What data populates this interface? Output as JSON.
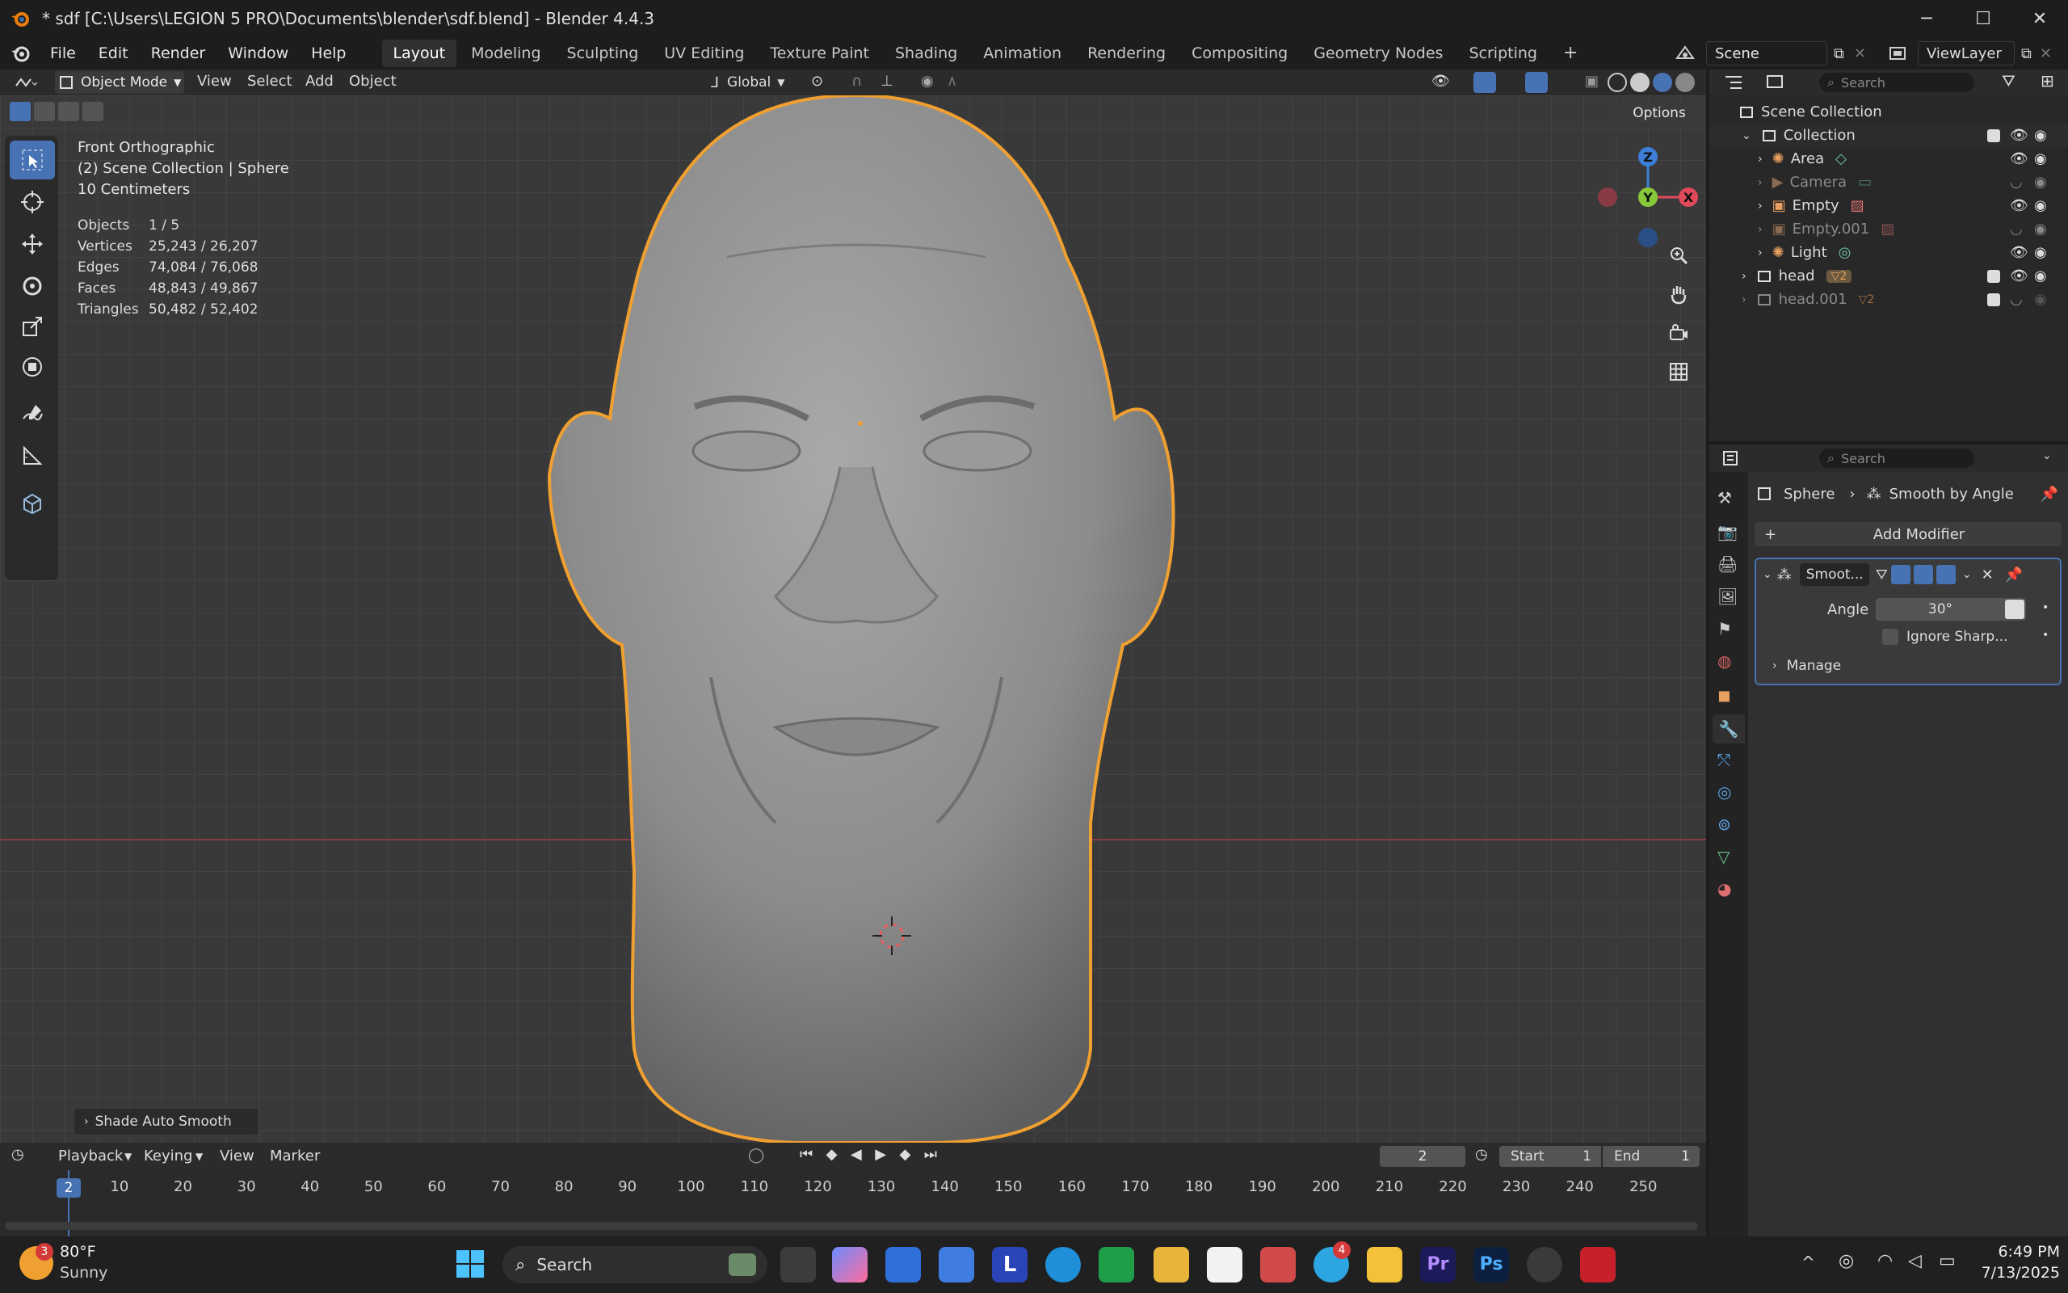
{
  "window": {
    "title": "* sdf [C:\\Users\\LEGION 5 PRO\\Documents\\blender\\sdf.blend] - Blender 4.4.3",
    "minimize": "─",
    "maximize": "☐",
    "close": "✕"
  },
  "menu": {
    "items": [
      "File",
      "Edit",
      "Render",
      "Window",
      "Help"
    ],
    "workspaces": [
      "Layout",
      "Modeling",
      "Sculpting",
      "UV Editing",
      "Texture Paint",
      "Shading",
      "Animation",
      "Rendering",
      "Compositing",
      "Geometry Nodes",
      "Scripting"
    ],
    "active_workspace": "Layout",
    "add_tab": "+",
    "scene": "Scene",
    "view_layer": "ViewLayer"
  },
  "viewport_header": {
    "mode": "Object Mode",
    "menus": [
      "View",
      "Select",
      "Add",
      "Object"
    ],
    "orientation": "Global",
    "options": "Options"
  },
  "viewport": {
    "view_name": "Front Orthographic",
    "collection_path": "(2) Scene Collection | Sphere",
    "scale": "10 Centimeters",
    "stats": [
      {
        "label": "Objects",
        "value": "1 / 5"
      },
      {
        "label": "Vertices",
        "value": "25,243 / 26,207"
      },
      {
        "label": "Edges",
        "value": "74,084 / 76,068"
      },
      {
        "label": "Faces",
        "value": "48,843 / 49,867"
      },
      {
        "label": "Triangles",
        "value": "50,482 / 52,402"
      }
    ],
    "gizmo_axes": {
      "z": "Z",
      "y": "Y",
      "x": "X"
    },
    "last_operation": "Shade Auto Smooth"
  },
  "outliner": {
    "search_placeholder": "Search",
    "root": "Scene Collection",
    "collection": "Collection",
    "items": [
      {
        "name": "Area",
        "dim": false
      },
      {
        "name": "Camera",
        "dim": true
      },
      {
        "name": "Empty",
        "dim": false
      },
      {
        "name": "Empty.001",
        "dim": true
      },
      {
        "name": "Light",
        "dim": false
      }
    ],
    "head": "head",
    "head_badge": "2",
    "head001": "head.001",
    "head001_badge": "2"
  },
  "properties": {
    "search_placeholder": "Search",
    "breadcrumb_object": "Sphere",
    "breadcrumb_modifier": "Smooth by Angle",
    "add_modifier": "Add Modifier",
    "modifier_name": "Smoot...",
    "angle_label": "Angle",
    "angle_value": "30°",
    "ignore_sharp": "Ignore Sharp...",
    "manage": "Manage"
  },
  "timeline": {
    "menus": [
      "Playback",
      "Keying",
      "View",
      "Marker"
    ],
    "current_frame": "2",
    "start_label": "Start",
    "start_value": "1",
    "end_label": "End",
    "end_value": "1",
    "ruler_current": "2",
    "ticks": [
      "10",
      "20",
      "30",
      "40",
      "50",
      "60",
      "70",
      "80",
      "90",
      "100",
      "110",
      "120",
      "130",
      "140",
      "150",
      "160",
      "170",
      "180",
      "190",
      "200",
      "210",
      "220",
      "230",
      "240",
      "250"
    ]
  },
  "taskbar": {
    "weather_badge": "3",
    "weather_temp": "80°F",
    "weather_desc": "Sunny",
    "search": "Search",
    "telegram_badge": "4",
    "time": "6:49 PM",
    "date": "7/13/2025"
  },
  "colors": {
    "accent": "#4772b3",
    "selection_outline": "#f0a030",
    "x_axis": "#e04a5a",
    "y_axis": "#88c93b",
    "z_axis": "#3d7fd6"
  }
}
